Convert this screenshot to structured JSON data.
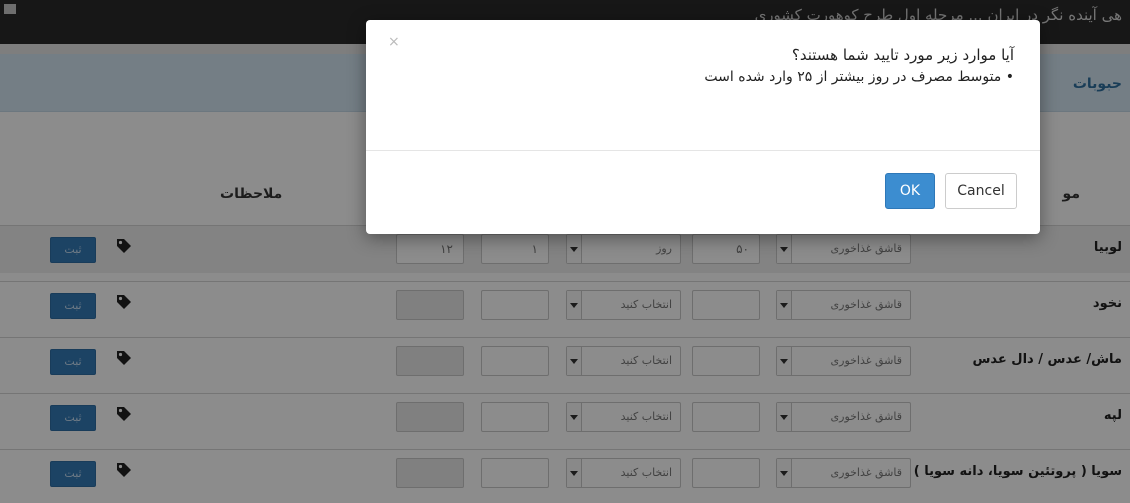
{
  "header": {
    "title": "هی آینده نگر در ایران ... مرحله اول طرح کوهورت کشوری"
  },
  "category": {
    "label": "حبوبات"
  },
  "columns": {
    "item": "مو",
    "notes": "ملاحظات"
  },
  "rows": [
    {
      "name": "لوبیا",
      "unit": "قاشق غذاخوری",
      "amount": "۵۰",
      "period": "روز",
      "frequency": "۱",
      "months": "۱۲",
      "submit": "ثبت"
    },
    {
      "name": "نخود",
      "unit": "قاشق غذاخوری",
      "amount": "",
      "period": "انتخاب کنید",
      "frequency": "",
      "months": "",
      "submit": "ثبت"
    },
    {
      "name": "ماش/ عدس / دال عدس",
      "unit": "قاشق غذاخوری",
      "amount": "",
      "period": "انتخاب کنید",
      "frequency": "",
      "months": "",
      "submit": "ثبت"
    },
    {
      "name": "لپه",
      "unit": "قاشق غذاخوری",
      "amount": "",
      "period": "انتخاب کنید",
      "frequency": "",
      "months": "",
      "submit": "ثبت"
    },
    {
      "name": "سویا ( پروتئین سویا، دانه سویا )",
      "unit": "قاشق غذاخوری",
      "amount": "",
      "period": "انتخاب کنید",
      "frequency": "",
      "months": "",
      "submit": "ثبت"
    }
  ],
  "dialog": {
    "close": "×",
    "question": "آیا موارد زیر مورد تایید شما هستند؟",
    "bullet": "• متوسط مصرف در روز بیشتر از ۲۵ وارد شده است",
    "ok": "OK",
    "cancel": "Cancel"
  },
  "colors": {
    "overlay": "#000000",
    "primary": "#337ab7",
    "category_bar": "#d4e6f3"
  }
}
